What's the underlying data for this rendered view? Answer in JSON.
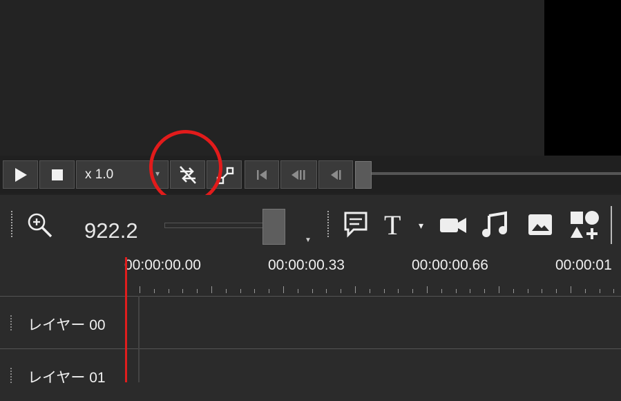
{
  "playback": {
    "speed_label": "x 1.0",
    "speed_arrow": "▾"
  },
  "toolbar": {
    "zoom_value": "922.2",
    "text_dropdown_arrow": "▾"
  },
  "timeline": {
    "timecodes": [
      "00:00:00.00",
      "00:00:00.33",
      "00:00:00.66",
      "00:00:01"
    ],
    "layers": [
      "レイヤー 00",
      "レイヤー 01"
    ]
  },
  "colors": {
    "annotation": "#e21b1b",
    "playhead": "#e01d1d"
  }
}
